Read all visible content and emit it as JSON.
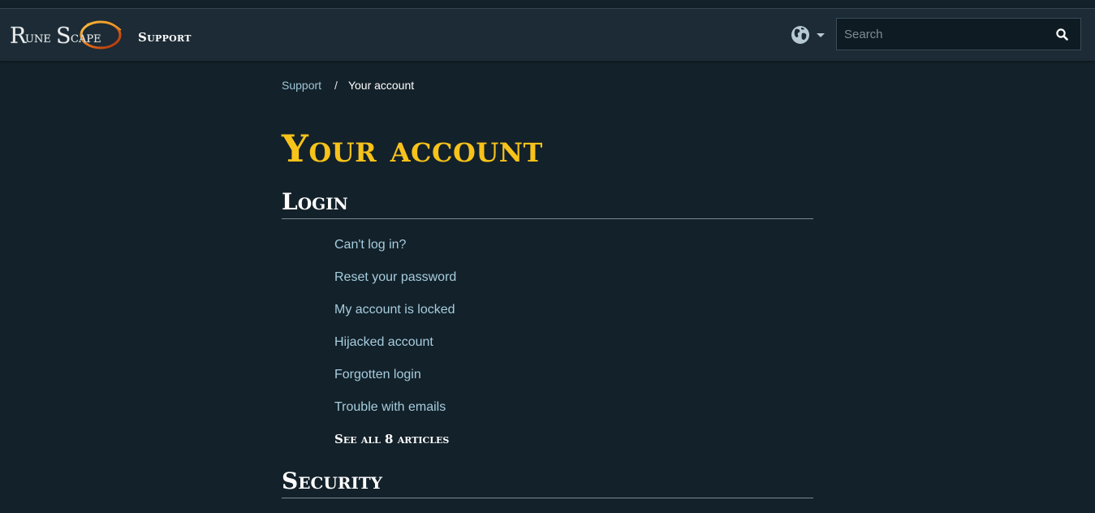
{
  "header": {
    "logo_text": "RuneScape",
    "support_label": "Support",
    "language_icon": "globe-icon",
    "search": {
      "placeholder": "Search",
      "value": "",
      "icon": "search-icon"
    }
  },
  "breadcrumb": {
    "items": [
      "Support",
      "Your account"
    ],
    "separator": "/"
  },
  "page": {
    "title": "Your account"
  },
  "sections": [
    {
      "title": "Login",
      "articles": [
        "Can't log in?",
        "Reset your password",
        "My account is locked",
        "Hijacked account",
        "Forgotten login",
        "Trouble with emails"
      ],
      "see_all_label": "See all 8 articles"
    },
    {
      "title": "Security"
    }
  ],
  "colors": {
    "background": "#13212a",
    "header": "#1c2b35",
    "title_gold": "#f7c21a",
    "link": "#a6cddd"
  }
}
